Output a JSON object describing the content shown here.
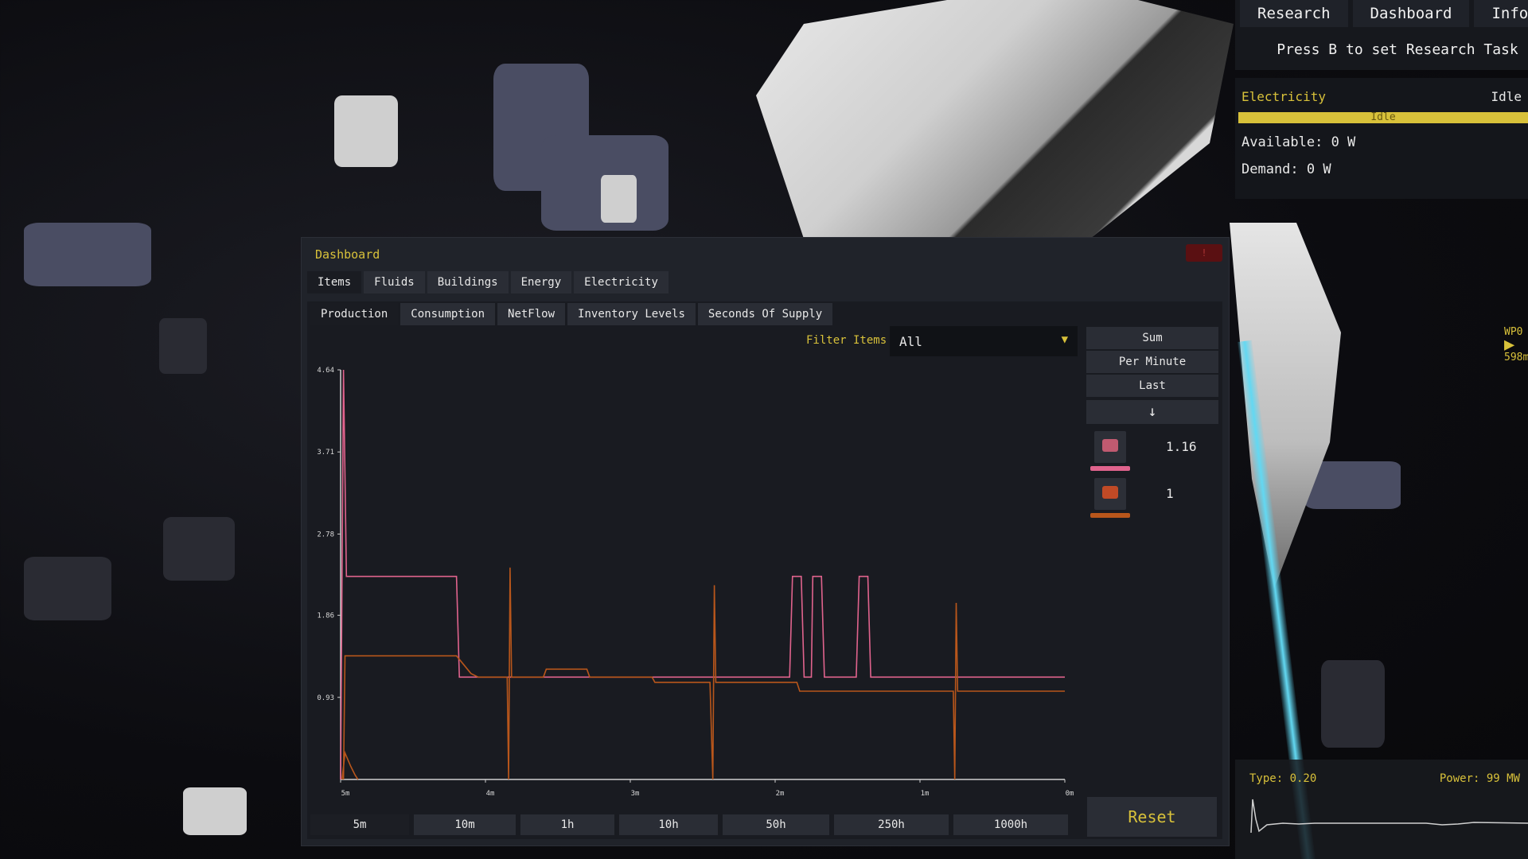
{
  "top_menu": {
    "tabs": [
      "Research",
      "Dashboard",
      "Info"
    ],
    "hint": "Press B to set Research Task"
  },
  "electricity_panel": {
    "title": "Electricity",
    "status": "Idle",
    "bar_label": "Idle",
    "available": "Available: 0 W",
    "demand": "Demand: 0 W",
    "accent": "#d8c13a"
  },
  "waypoint": {
    "name": "WP0",
    "distance": "598m"
  },
  "bottom_graph": {
    "type_label": "Type: 0.20",
    "power_label": "Power: 99 MW"
  },
  "dashboard": {
    "title": "Dashboard",
    "main_tabs": [
      "Items",
      "Fluids",
      "Buildings",
      "Energy",
      "Electricity"
    ],
    "sub_tabs": [
      "Production",
      "Consumption",
      "NetFlow",
      "Inventory Levels",
      "Seconds Of Supply"
    ],
    "filter_label": "Filter Items",
    "filter_value": "All",
    "side_buttons": [
      "Sum",
      "Per Minute",
      "Last",
      "↓"
    ],
    "legend": [
      {
        "icon": "ore-chunk-icon",
        "color": "#e0638d",
        "value": "1.16"
      },
      {
        "icon": "ingot-icon",
        "color": "#b8561b",
        "value": "1"
      }
    ],
    "time_ranges": [
      "5m",
      "10m",
      "1h",
      "10h",
      "50h",
      "250h",
      "1000h"
    ],
    "active_range": "5m",
    "reset_label": "Reset"
  },
  "chart_data": {
    "type": "line",
    "y_ticks": [
      "4.64",
      "3.71",
      "2.78",
      "1.86",
      "0.93"
    ],
    "x_ticks": [
      "5m",
      "4m",
      "3m",
      "2m",
      "1m",
      "0m"
    ],
    "ylim": [
      0,
      4.64
    ],
    "xlim": [
      5,
      0
    ],
    "series": [
      {
        "color": "#e0638d",
        "points": [
          [
            5,
            0
          ],
          [
            4.98,
            4.64
          ],
          [
            4.96,
            2.3
          ],
          [
            4.2,
            2.3
          ],
          [
            4.18,
            1.16
          ],
          [
            1.9,
            1.16
          ],
          [
            1.88,
            2.3
          ],
          [
            1.82,
            2.3
          ],
          [
            1.8,
            1.16
          ],
          [
            1.75,
            1.16
          ],
          [
            1.74,
            2.3
          ],
          [
            1.68,
            2.3
          ],
          [
            1.66,
            1.16
          ],
          [
            1.44,
            1.16
          ],
          [
            1.42,
            2.3
          ],
          [
            1.36,
            2.3
          ],
          [
            1.34,
            1.16
          ],
          [
            0,
            1.16
          ]
        ]
      },
      {
        "color": "#b8561b",
        "points": [
          [
            4.98,
            0
          ],
          [
            4.97,
            1.4
          ],
          [
            4.2,
            1.4
          ],
          [
            4.1,
            1.2
          ],
          [
            4.05,
            1.16
          ],
          [
            3.85,
            1.16
          ],
          [
            3.84,
            0
          ],
          [
            3.83,
            2.4
          ],
          [
            3.82,
            1.16
          ],
          [
            3.6,
            1.16
          ],
          [
            3.58,
            1.25
          ],
          [
            3.3,
            1.25
          ],
          [
            3.28,
            1.16
          ],
          [
            2.85,
            1.16
          ],
          [
            2.83,
            1.1
          ],
          [
            2.45,
            1.1
          ],
          [
            2.43,
            0
          ],
          [
            2.42,
            2.2
          ],
          [
            2.41,
            1.1
          ],
          [
            1.85,
            1.1
          ],
          [
            1.83,
            1.0
          ],
          [
            0.77,
            1.0
          ],
          [
            0.76,
            0
          ],
          [
            0.75,
            2.0
          ],
          [
            0.74,
            1.0
          ],
          [
            0,
            1.0
          ]
        ]
      },
      {
        "color": "#b8561b",
        "points": [
          [
            4.99,
            0
          ],
          [
            4.97,
            0.3
          ],
          [
            4.93,
            0.15
          ],
          [
            4.9,
            0.05
          ],
          [
            4.88,
            0
          ]
        ]
      }
    ]
  }
}
